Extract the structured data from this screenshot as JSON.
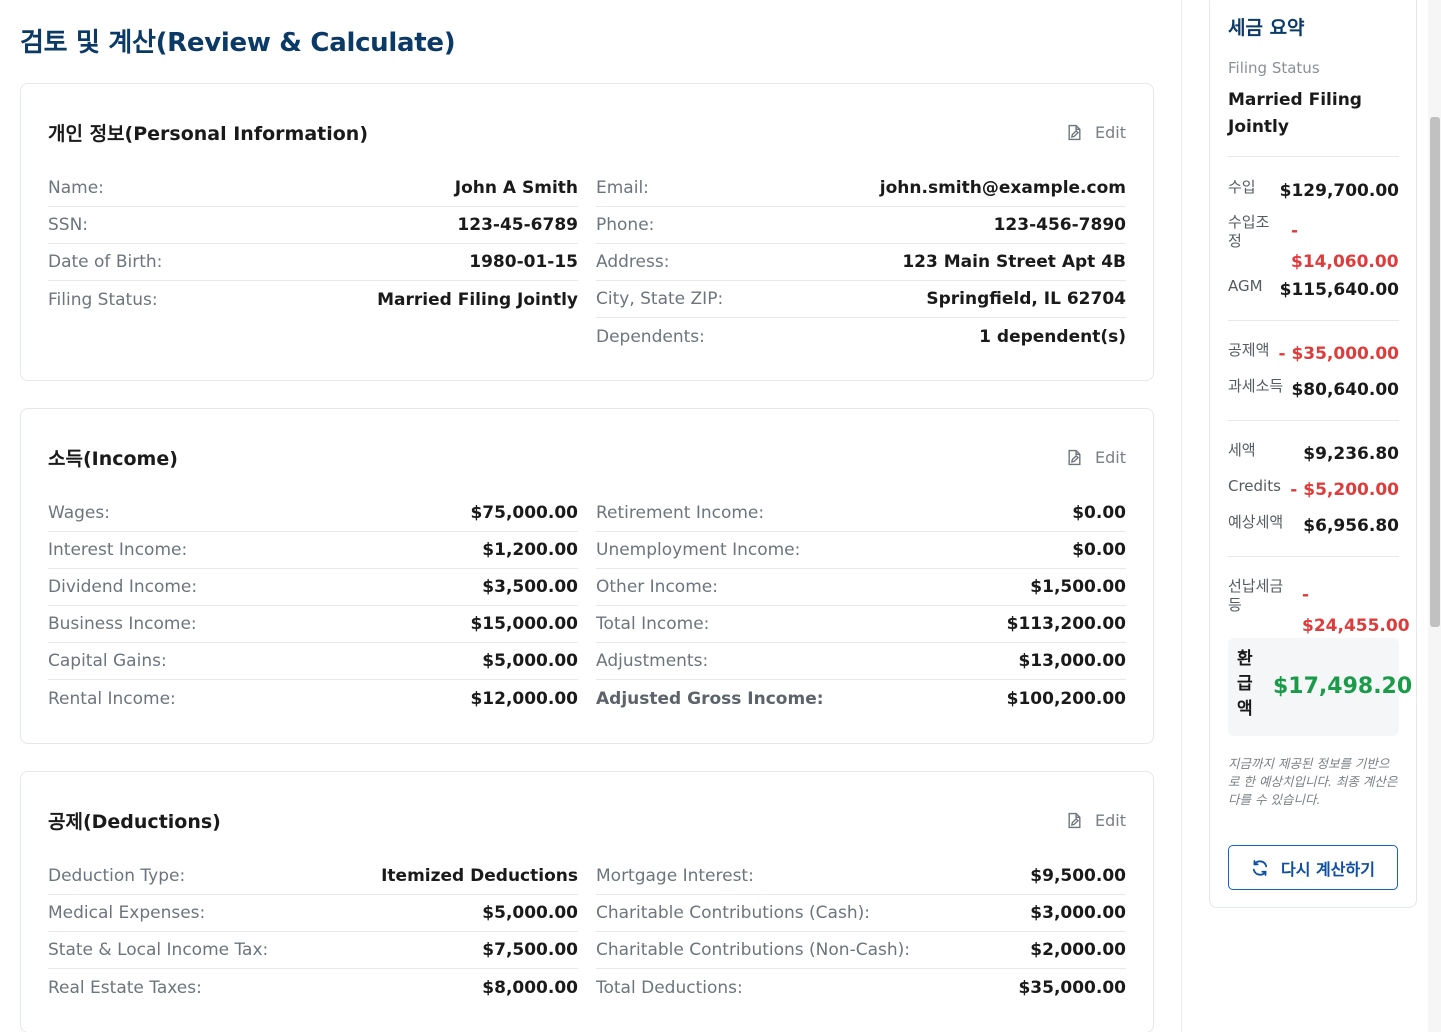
{
  "page_title": "검토 및 계산(Review & Calculate)",
  "edit_label": "Edit",
  "sections": {
    "personal": {
      "title": "개인 정보(Personal Information)",
      "left": [
        {
          "label": "Name:",
          "value": "John A Smith"
        },
        {
          "label": "SSN:",
          "value": "123-45-6789"
        },
        {
          "label": "Date of Birth:",
          "value": "1980-01-15"
        },
        {
          "label": "Filing Status:",
          "value": "Married Filing Jointly"
        }
      ],
      "right": [
        {
          "label": "Email:",
          "value": "john.smith@example.com"
        },
        {
          "label": "Phone:",
          "value": "123-456-7890"
        },
        {
          "label": "Address:",
          "value": "123 Main Street Apt 4B"
        },
        {
          "label": "City, State ZIP:",
          "value": "Springfield, IL 62704"
        },
        {
          "label": "Dependents:",
          "value": "1 dependent(s)"
        }
      ]
    },
    "income": {
      "title": "소득(Income)",
      "left": [
        {
          "label": "Wages:",
          "value": "$75,000.00"
        },
        {
          "label": "Interest Income:",
          "value": "$1,200.00"
        },
        {
          "label": "Dividend Income:",
          "value": "$3,500.00"
        },
        {
          "label": "Business Income:",
          "value": "$15,000.00"
        },
        {
          "label": "Capital Gains:",
          "value": "$5,000.00"
        },
        {
          "label": "Rental Income:",
          "value": "$12,000.00"
        }
      ],
      "right": [
        {
          "label": "Retirement Income:",
          "value": "$0.00"
        },
        {
          "label": "Unemployment Income:",
          "value": "$0.00"
        },
        {
          "label": "Other Income:",
          "value": "$1,500.00"
        },
        {
          "label": "Total Income:",
          "value": "$113,200.00"
        },
        {
          "label": "Adjustments:",
          "value": "$13,000.00"
        },
        {
          "label": "Adjusted Gross Income:",
          "value": "$100,200.00"
        }
      ]
    },
    "deductions": {
      "title": "공제(Deductions)",
      "left": [
        {
          "label": "Deduction Type:",
          "value": "Itemized Deductions"
        },
        {
          "label": "Medical Expenses:",
          "value": "$5,000.00"
        },
        {
          "label": "State & Local Income Tax:",
          "value": "$7,500.00"
        },
        {
          "label": "Real Estate Taxes:",
          "value": "$8,000.00"
        }
      ],
      "right": [
        {
          "label": "Mortgage Interest:",
          "value": "$9,500.00"
        },
        {
          "label": "Charitable Contributions (Cash):",
          "value": "$3,000.00"
        },
        {
          "label": "Charitable Contributions (Non-Cash):",
          "value": "$2,000.00"
        },
        {
          "label": "Total Deductions:",
          "value": "$35,000.00"
        }
      ]
    }
  },
  "summary": {
    "title": "세금 요약",
    "filing_status_label": "Filing Status",
    "filing_status_value": "Married Filing Jointly",
    "income_label": "수입",
    "income_value": "$129,700.00",
    "adjustments_label": "수입조정",
    "adjustments_value": "- $14,060.00",
    "agm_label": "AGM",
    "agm_value": "$115,640.00",
    "deductions_label": "공제액",
    "deductions_value": "- $35,000.00",
    "taxable_label": "과세소득",
    "taxable_value": "$80,640.00",
    "tax_label": "세액",
    "tax_value": "$9,236.80",
    "credits_label": "Credits",
    "credits_value": "- $5,200.00",
    "estimated_label": "예상세액",
    "estimated_value": "$6,956.80",
    "prepaid_label": "선납세금등",
    "prepaid_value": "- $24,455.00",
    "refund_label": "환급액",
    "refund_value": "$17,498.20",
    "note": "지금까지 제공된 정보를 기반으로 한 예상치입니다. 최종 계산은 다를 수 있습니다.",
    "recalculate_label": "다시 계산하기"
  },
  "colors": {
    "title": "#0b3a66",
    "negative": "#e03b3b",
    "refund": "#1c9a4a",
    "button_border": "#1565c0"
  },
  "icons": [
    "edit-icon",
    "refresh-icon"
  ]
}
